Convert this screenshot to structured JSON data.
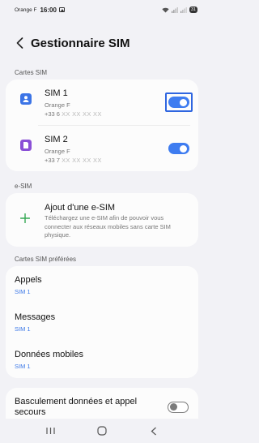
{
  "status_bar": {
    "carrier": "Orange F",
    "time": "16:00",
    "battery": "31"
  },
  "header": {
    "title": "Gestionnaire SIM"
  },
  "sections": {
    "sim_cards": "Cartes SIM",
    "esim": "e-SIM",
    "preferred": "Cartes SIM préférées"
  },
  "sims": [
    {
      "name": "SIM 1",
      "carrier": "Orange F",
      "number_prefix": "+33 6",
      "number_mask": "XX XX XX XX",
      "enabled": true,
      "icon": "sim-card-person-icon",
      "color": "#3b74e6"
    },
    {
      "name": "SIM 2",
      "carrier": "Orange F",
      "number_prefix": "+33 7",
      "number_mask": "XX XX XX XX",
      "enabled": true,
      "icon": "sim-card-icon",
      "color": "#8a4fd6"
    }
  ],
  "esim": {
    "title": "Ajout d'une e-SIM",
    "description": "Téléchargez une e-SIM afin de pouvoir vous connecter aux réseaux mobiles sans carte SIM physique.",
    "icon": "plus-icon",
    "icon_color": "#34a853"
  },
  "preferred": [
    {
      "label": "Appels",
      "value": "SIM 1"
    },
    {
      "label": "Messages",
      "value": "SIM 1"
    },
    {
      "label": "Données mobiles",
      "value": "SIM 1"
    }
  ],
  "failover": {
    "label": "Basculement données et appel secours",
    "enabled": false
  },
  "accent_color": "#3e7cf0"
}
